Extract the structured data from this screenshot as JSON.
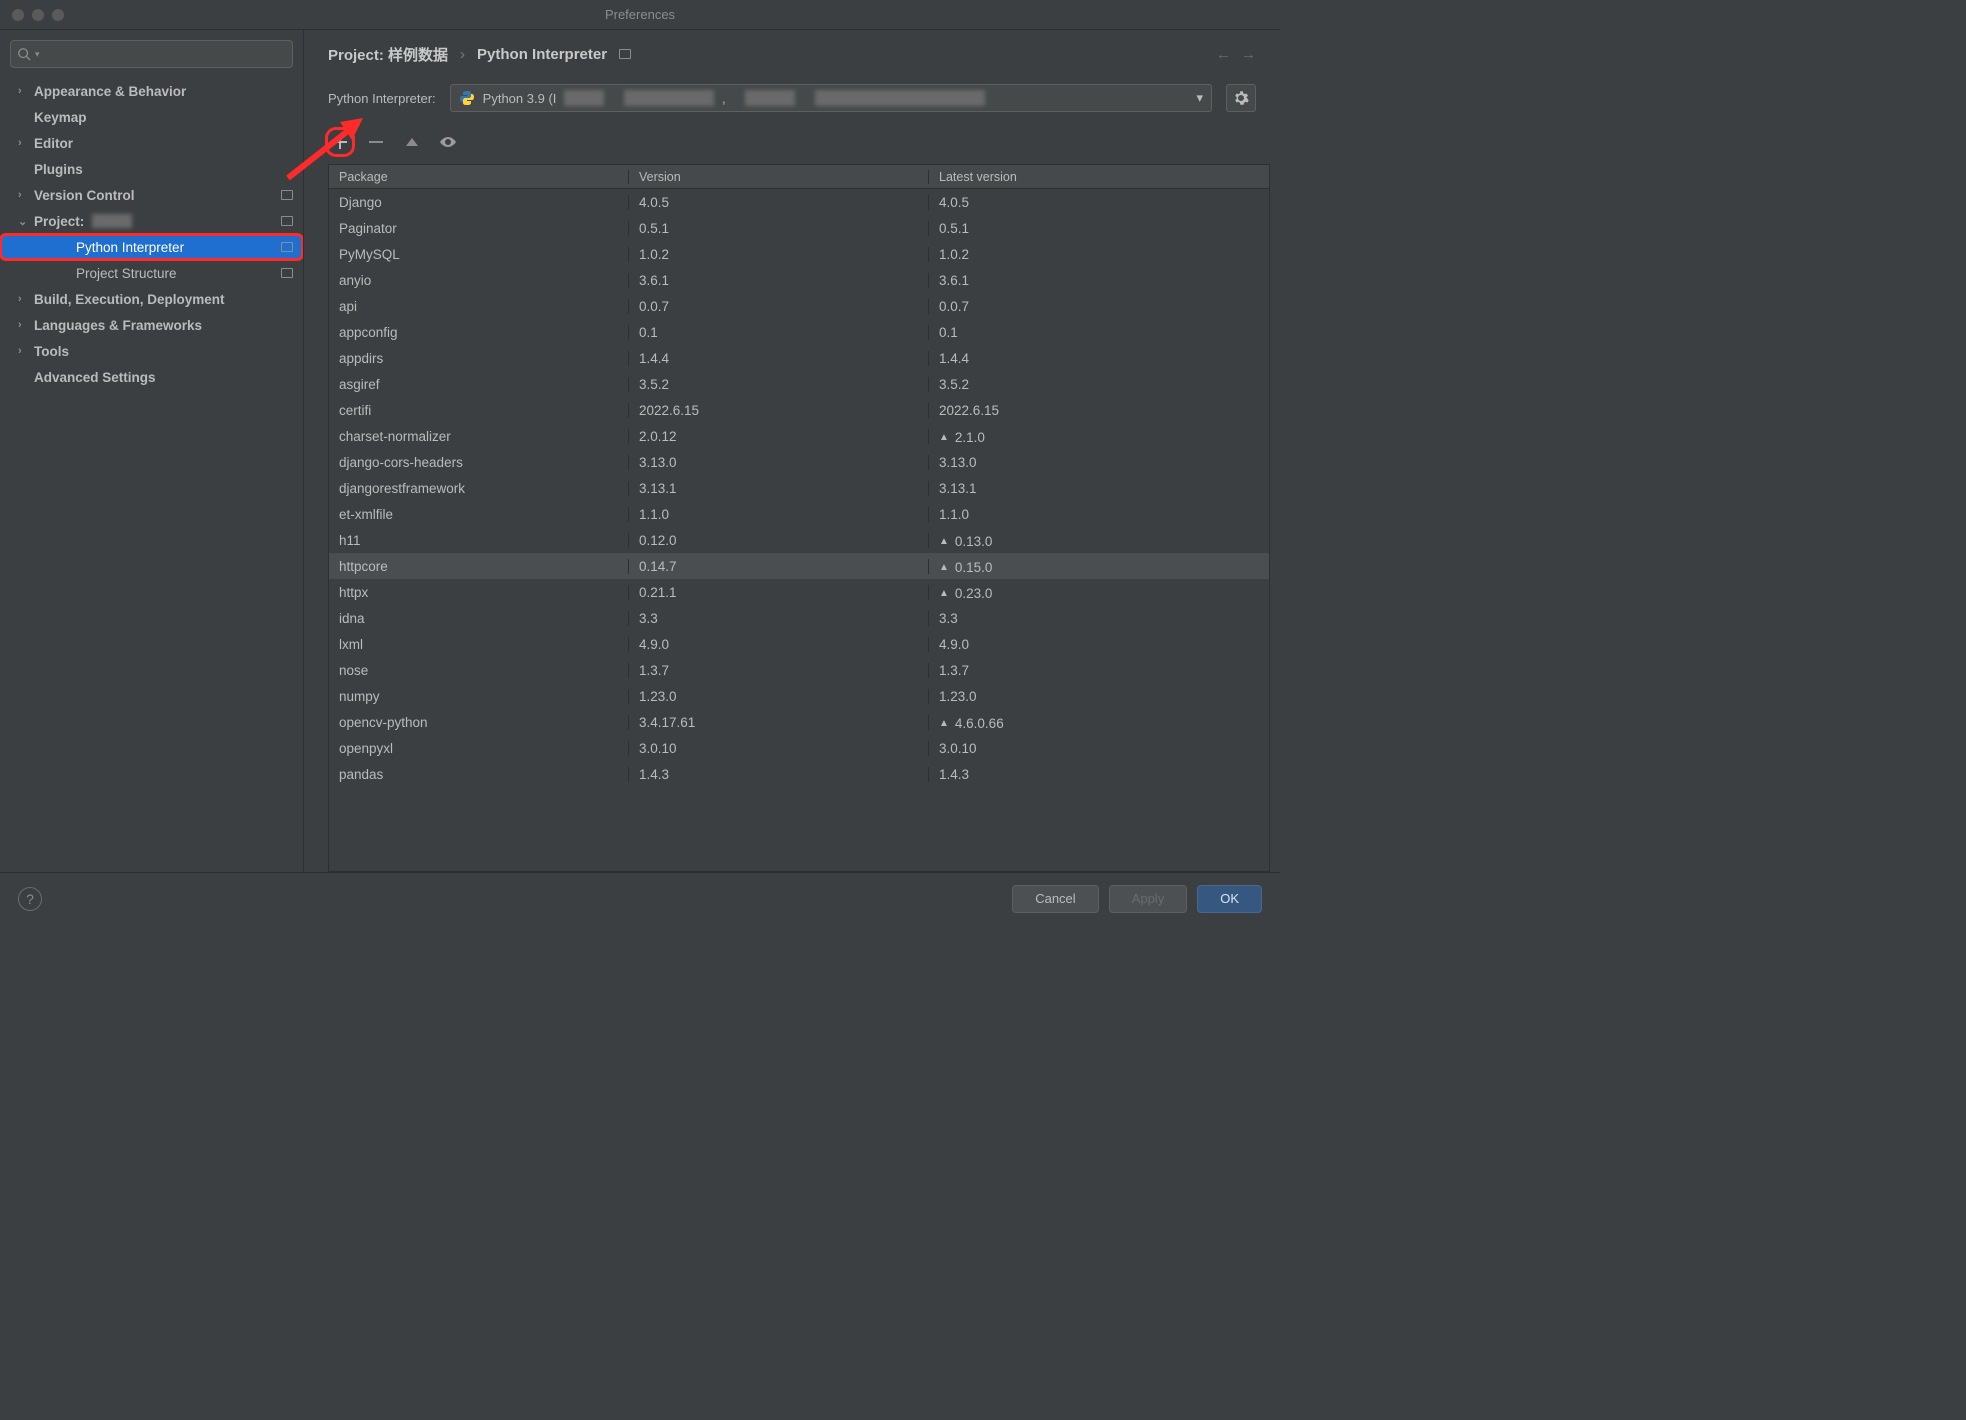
{
  "window": {
    "title": "Preferences"
  },
  "sidebar": {
    "items": [
      {
        "label": "Appearance & Behavior",
        "expandable": true,
        "open": false,
        "bold": true
      },
      {
        "label": "Keymap",
        "expandable": false,
        "bold": true
      },
      {
        "label": "Editor",
        "expandable": true,
        "open": false,
        "bold": true
      },
      {
        "label": "Plugins",
        "expandable": false,
        "bold": true
      },
      {
        "label": "Version Control",
        "expandable": true,
        "open": false,
        "bold": true,
        "reset": true
      },
      {
        "label": "Project: ",
        "expandable": true,
        "open": true,
        "bold": true,
        "reset": true
      },
      {
        "label": "Python Interpreter",
        "sub": true,
        "selected": true,
        "reset": true
      },
      {
        "label": "Project Structure",
        "sub": true,
        "reset": true
      },
      {
        "label": "Build, Execution, Deployment",
        "expandable": true,
        "open": false,
        "bold": true
      },
      {
        "label": "Languages & Frameworks",
        "expandable": true,
        "open": false,
        "bold": true
      },
      {
        "label": "Tools",
        "expandable": true,
        "open": false,
        "bold": true
      },
      {
        "label": "Advanced Settings",
        "expandable": false,
        "bold": true
      }
    ]
  },
  "breadcrumb": {
    "project_prefix": "Project: ",
    "project_name": "样例数据",
    "page": "Python Interpreter"
  },
  "interpreter": {
    "label": "Python Interpreter:",
    "selected": "Python 3.9 (I"
  },
  "columns": {
    "c1": "Package",
    "c2": "Version",
    "c3": "Latest version"
  },
  "packages": [
    {
      "name": "Django",
      "version": "4.0.5",
      "latest": "4.0.5"
    },
    {
      "name": "Paginator",
      "version": "0.5.1",
      "latest": "0.5.1"
    },
    {
      "name": "PyMySQL",
      "version": "1.0.2",
      "latest": "1.0.2"
    },
    {
      "name": "anyio",
      "version": "3.6.1",
      "latest": "3.6.1"
    },
    {
      "name": "api",
      "version": "0.0.7",
      "latest": "0.0.7"
    },
    {
      "name": "appconfig",
      "version": "0.1",
      "latest": "0.1"
    },
    {
      "name": "appdirs",
      "version": "1.4.4",
      "latest": "1.4.4"
    },
    {
      "name": "asgiref",
      "version": "3.5.2",
      "latest": "3.5.2"
    },
    {
      "name": "certifi",
      "version": "2022.6.15",
      "latest": "2022.6.15"
    },
    {
      "name": "charset-normalizer",
      "version": "2.0.12",
      "latest": "2.1.0",
      "upgrade": true
    },
    {
      "name": "django-cors-headers",
      "version": "3.13.0",
      "latest": "3.13.0"
    },
    {
      "name": "djangorestframework",
      "version": "3.13.1",
      "latest": "3.13.1"
    },
    {
      "name": "et-xmlfile",
      "version": "1.1.0",
      "latest": "1.1.0"
    },
    {
      "name": "h11",
      "version": "0.12.0",
      "latest": "0.13.0",
      "upgrade": true
    },
    {
      "name": "httpcore",
      "version": "0.14.7",
      "latest": "0.15.0",
      "upgrade": true,
      "hover": true
    },
    {
      "name": "httpx",
      "version": "0.21.1",
      "latest": "0.23.0",
      "upgrade": true
    },
    {
      "name": "idna",
      "version": "3.3",
      "latest": "3.3"
    },
    {
      "name": "lxml",
      "version": "4.9.0",
      "latest": "4.9.0"
    },
    {
      "name": "nose",
      "version": "1.3.7",
      "latest": "1.3.7"
    },
    {
      "name": "numpy",
      "version": "1.23.0",
      "latest": "1.23.0"
    },
    {
      "name": "opencv-python",
      "version": "3.4.17.61",
      "latest": "4.6.0.66",
      "upgrade": true
    },
    {
      "name": "openpyxl",
      "version": "3.0.10",
      "latest": "3.0.10"
    },
    {
      "name": "pandas",
      "version": "1.4.3",
      "latest": "1.4.3"
    }
  ],
  "footer": {
    "cancel": "Cancel",
    "apply": "Apply",
    "ok": "OK"
  }
}
